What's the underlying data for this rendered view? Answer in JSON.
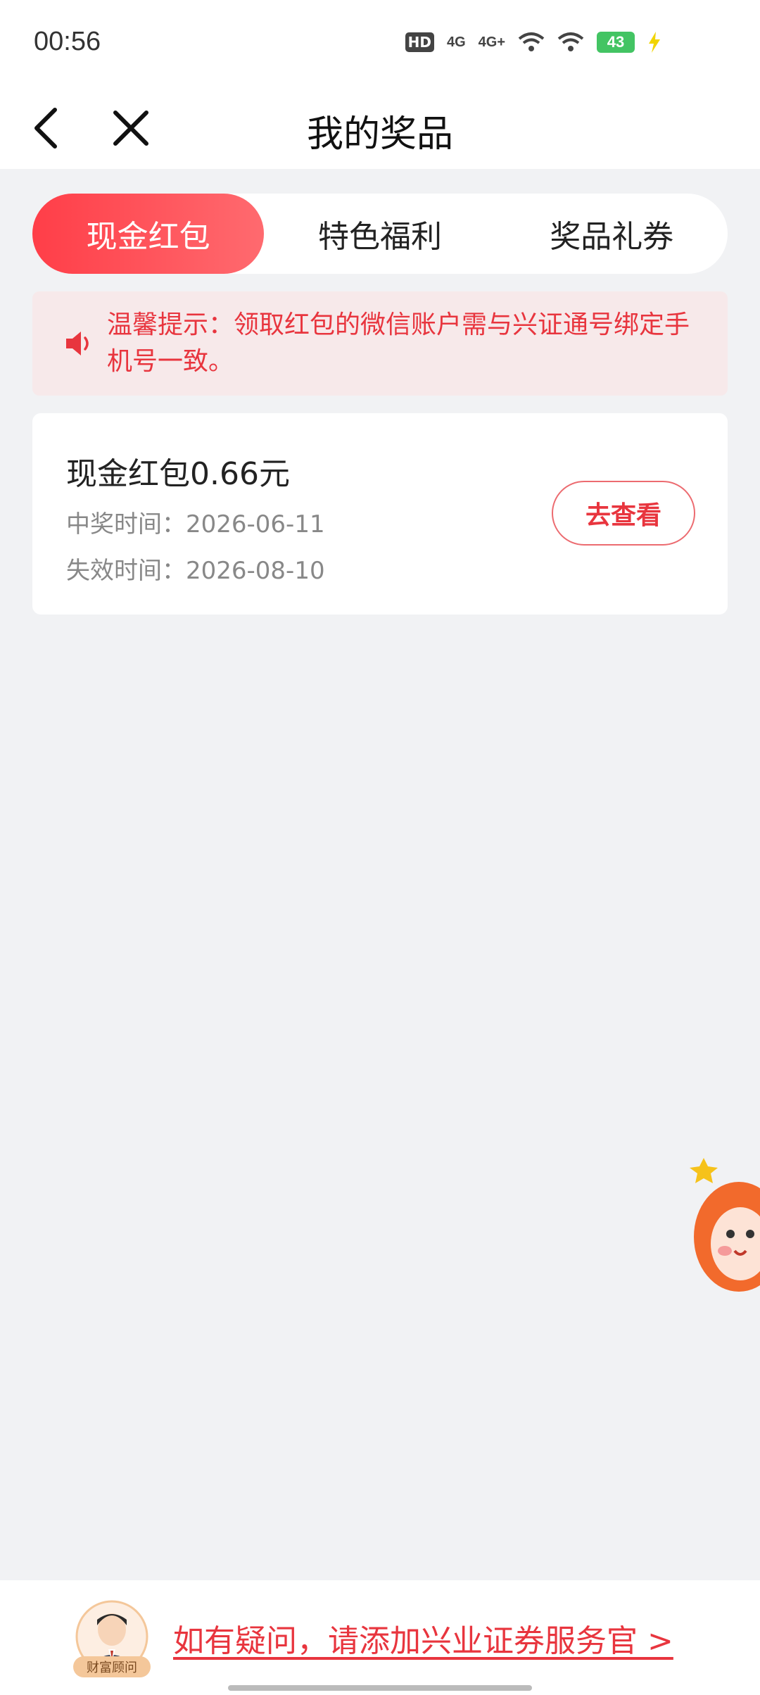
{
  "status_bar": {
    "time": "00:56",
    "hd": "HD",
    "net1": "4G",
    "net2": "4G+",
    "battery": "43"
  },
  "header": {
    "title": "我的奖品",
    "back_icon": "chevron-left-icon",
    "close_icon": "close-icon"
  },
  "tabs": [
    {
      "label": "现金红包",
      "active": true
    },
    {
      "label": "特色福利",
      "active": false
    },
    {
      "label": "奖品礼券",
      "active": false
    }
  ],
  "notice": {
    "icon": "speaker-icon",
    "text": "温馨提示：领取红包的微信账户需与兴证通号绑定手机号一致。"
  },
  "prize": {
    "title": "现金红包0.66元",
    "win_time": "中奖时间：2026-06-11",
    "expire_time": "失效时间：2026-08-10",
    "button_label": "去查看"
  },
  "bottom": {
    "advisor_badge": "财富顾问",
    "service_link": "如有疑问，请添加兴业证券服务官 >"
  },
  "colors": {
    "accent": "#e8353e",
    "tab_gradient_start": "#ff3e48",
    "tab_gradient_end": "#ff6a6f",
    "notice_bg": "#f7e9ea",
    "page_bg": "#f1f2f4"
  }
}
